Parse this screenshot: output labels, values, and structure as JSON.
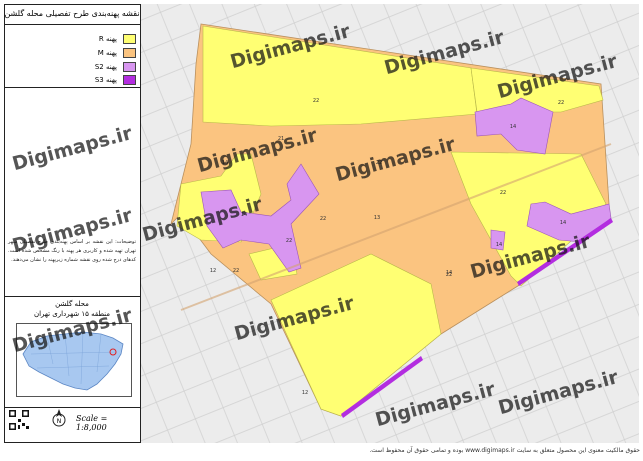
{
  "title": "نقشه پهنه‌بندی طرح تفصیلی محله گلشن",
  "legend": [
    {
      "label": "پهنه R",
      "color": "#ffff73"
    },
    {
      "label": "پهنه M",
      "color": "#fbc480"
    },
    {
      "label": "پهنه S2",
      "color": "#d896f0"
    },
    {
      "label": "پهنه S3",
      "color": "#b32de0"
    }
  ],
  "note": "توضیحات: این نقشه بر اساس پهنه‌بندی طرح تفصیلی شهر تهران تهیه شده و کاربری هر پهنه با رنگ مشخص شده است. کدهای درج شده روی نقشه شماره زیرپهنه را نشان می‌دهند.",
  "location": {
    "title": "محله گلشن",
    "subtitle": "منطقه ۱۵ شهرداری تهران"
  },
  "scale": "Scale = 1:8,000",
  "watermark": "Digimaps.ir",
  "footer": "حقوق مالکیت معنوی این محصول متعلق به سایت www.digimaps.ir بوده و تمامی حقوق آن محفوظ است.",
  "zones": [
    {
      "code": "22"
    },
    {
      "code": "22"
    },
    {
      "code": "21"
    },
    {
      "code": "22"
    },
    {
      "code": "14"
    },
    {
      "code": "22"
    },
    {
      "code": "14"
    },
    {
      "code": "22"
    },
    {
      "code": "22"
    },
    {
      "code": "13"
    },
    {
      "code": "14"
    },
    {
      "code": "12"
    },
    {
      "code": "22"
    },
    {
      "code": "14"
    },
    {
      "code": "14"
    },
    {
      "code": "22"
    },
    {
      "code": "12"
    },
    {
      "code": "14"
    }
  ]
}
